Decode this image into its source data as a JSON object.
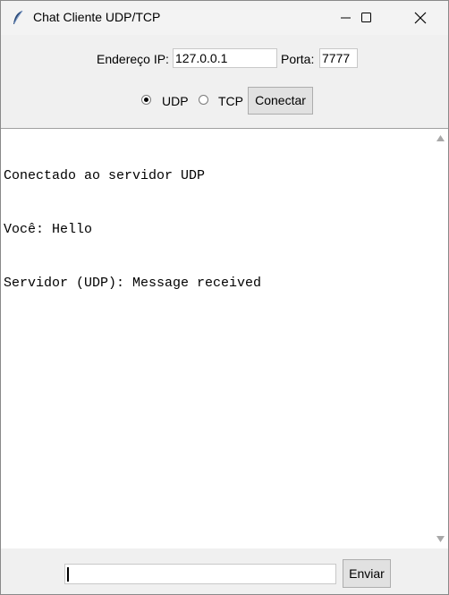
{
  "window": {
    "title": "Chat Cliente UDP/TCP",
    "icon": "feather-icon"
  },
  "connection": {
    "ip_label": "Endereço IP:",
    "ip_value": "127.0.0.1",
    "port_label": "Porta:",
    "port_value": "7777",
    "protocols": [
      {
        "label": "UDP",
        "selected": true
      },
      {
        "label": "TCP",
        "selected": false
      }
    ],
    "connect_label": "Conectar"
  },
  "chat": {
    "messages": [
      "Conectado ao servidor UDP",
      "Você: Hello",
      "Servidor (UDP): Message received"
    ]
  },
  "composer": {
    "message_value": "",
    "send_label": "Enviar"
  },
  "colors": {
    "background": "#f0f0f0",
    "chat_background": "#ffffff",
    "button_background": "#e1e1e1"
  }
}
